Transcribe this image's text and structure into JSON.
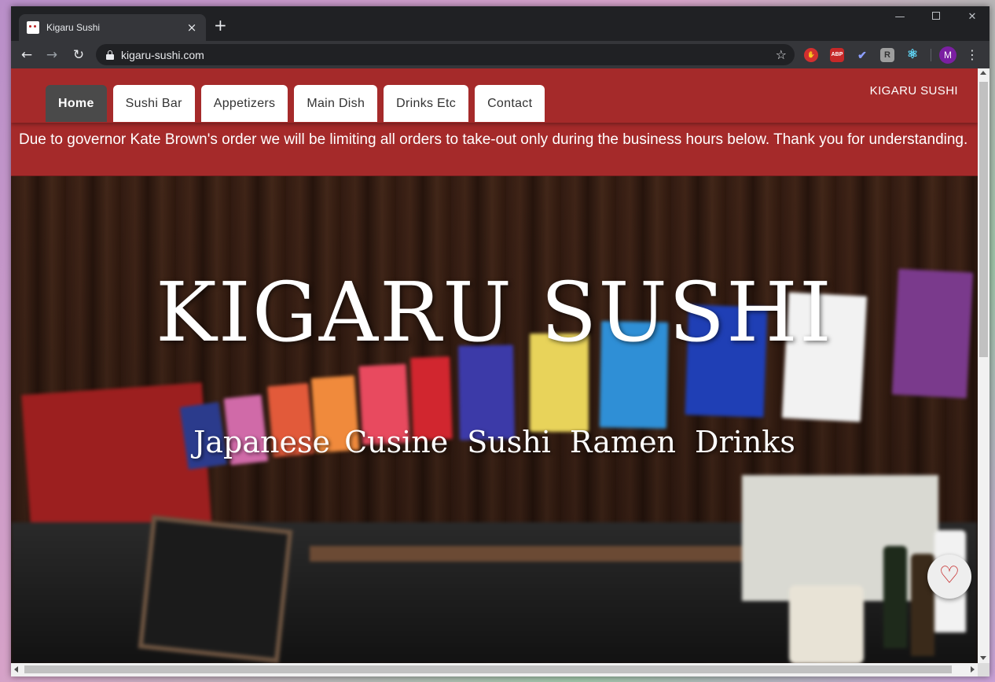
{
  "browser": {
    "tab_title": "Kigaru Sushi",
    "tab_close": "×",
    "new_tab": "+",
    "url": "kigaru-sushi.com",
    "window_controls": {
      "minimize": "—",
      "maximize": "",
      "close": "✕"
    },
    "nav": {
      "back": "←",
      "forward": "→",
      "reload": "↻"
    },
    "star": "☆",
    "extensions": [
      {
        "icon": "hand-stop-extension-icon",
        "label": "✋"
      },
      {
        "icon": "adblock-plus-icon",
        "label": "ABP"
      },
      {
        "icon": "checkmark-extension-icon",
        "label": "✔"
      },
      {
        "icon": "r-extension-icon",
        "label": "R"
      },
      {
        "icon": "react-devtools-icon",
        "label": "⚛"
      }
    ],
    "profile_initial": "M",
    "menu": "⋮"
  },
  "site": {
    "nav": {
      "tabs": [
        "Home",
        "Sushi Bar",
        "Appetizers",
        "Main Dish",
        "Drinks Etc",
        "Contact"
      ],
      "active_tab": "Home",
      "brand": "KIGARU SUSHI"
    },
    "notice": "Due to governor Kate Brown's order we will be limiting all orders to take-out only during the business hours below. Thank you for understanding.",
    "hero": {
      "title": "KIGARU SUSHI",
      "subtitle": [
        "Japanese Cusine",
        "Sushi",
        "Ramen",
        "Drinks"
      ]
    },
    "favorite_button": "♡"
  },
  "colors": {
    "brand_red": "#a52a2a",
    "active_tab": "#4a4a4a",
    "heart": "#c62828"
  }
}
